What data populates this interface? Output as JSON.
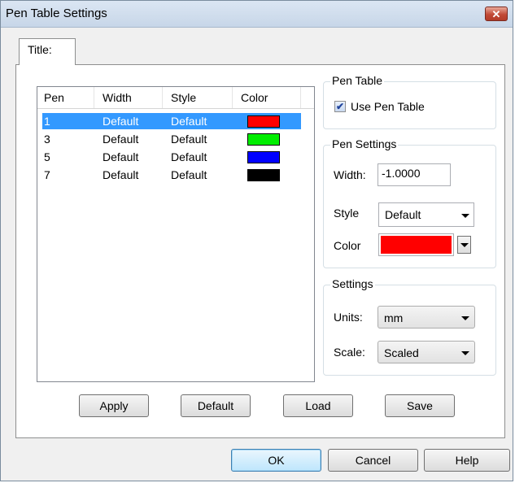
{
  "window": {
    "title": "Pen Table Settings",
    "close_glyph": "✕"
  },
  "tabs": [
    {
      "label": "Title:"
    }
  ],
  "pen_list": {
    "columns": [
      "Pen",
      "Width",
      "Style",
      "Color"
    ],
    "rows": [
      {
        "pen": "1",
        "width": "Default",
        "style": "Default",
        "color": "#ff0000",
        "selected": true
      },
      {
        "pen": "3",
        "width": "Default",
        "style": "Default",
        "color": "#00ee00",
        "selected": false
      },
      {
        "pen": "5",
        "width": "Default",
        "style": "Default",
        "color": "#0000ff",
        "selected": false
      },
      {
        "pen": "7",
        "width": "Default",
        "style": "Default",
        "color": "#000000",
        "selected": false
      }
    ]
  },
  "pen_table_group": {
    "title": "Pen Table",
    "use_pen_table_label": "Use Pen Table",
    "use_pen_table_checked": true,
    "check_glyph": "✔"
  },
  "pen_settings_group": {
    "title": "Pen Settings",
    "width_label": "Width:",
    "width_value": "-1.0000",
    "style_label": "Style",
    "style_value": "Default",
    "color_label": "Color",
    "color_value": "#ff0000"
  },
  "settings_group": {
    "title": "Settings",
    "units_label": "Units:",
    "units_value": "mm",
    "scale_label": "Scale:",
    "scale_value": "Scaled"
  },
  "panel_buttons": {
    "apply": "Apply",
    "default": "Default",
    "load": "Load",
    "save": "Save"
  },
  "dialog_buttons": {
    "ok": "OK",
    "cancel": "Cancel",
    "help": "Help"
  },
  "colors": {
    "selection": "#3399ff",
    "close_button": "#c24a36"
  }
}
